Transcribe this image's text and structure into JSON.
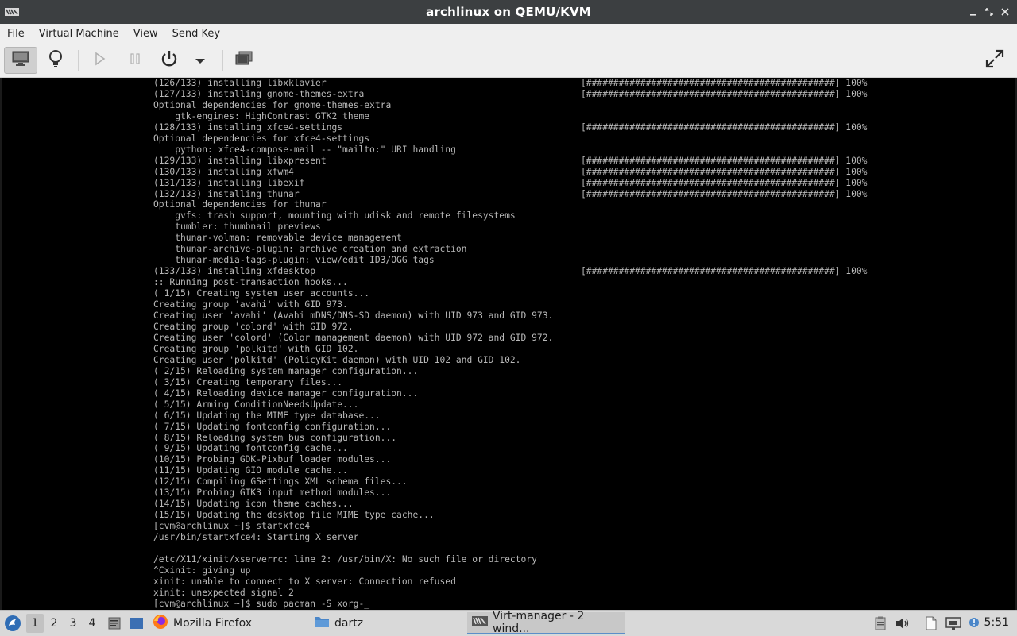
{
  "window": {
    "title": "archlinux on QEMU/KVM",
    "minimize_icon": "minimize-icon",
    "maximize_icon": "maximize-icon",
    "close_icon": "close-icon"
  },
  "menubar": {
    "items": [
      "File",
      "Virtual Machine",
      "View",
      "Send Key"
    ]
  },
  "toolbar": {
    "buttons": [
      "console-view",
      "details-view",
      "run",
      "pause",
      "shutdown",
      "shutdown-menu",
      "snapshots",
      "fullscreen"
    ]
  },
  "console": {
    "lines": [
      "(126/133) installing libxklavier",
      "(127/133) installing gnome-themes-extra",
      "Optional dependencies for gnome-themes-extra",
      "    gtk-engines: HighContrast GTK2 theme",
      "(128/133) installing xfce4-settings",
      "Optional dependencies for xfce4-settings",
      "    python: xfce4-compose-mail -- \"mailto:\" URI handling",
      "(129/133) installing libxpresent",
      "(130/133) installing xfwm4",
      "(131/133) installing libexif",
      "(132/133) installing thunar",
      "Optional dependencies for thunar",
      "    gvfs: trash support, mounting with udisk and remote filesystems",
      "    tumbler: thumbnail previews",
      "    thunar-volman: removable device management",
      "    thunar-archive-plugin: archive creation and extraction",
      "    thunar-media-tags-plugin: view/edit ID3/OGG tags",
      "(133/133) installing xfdesktop",
      ":: Running post-transaction hooks...",
      "( 1/15) Creating system user accounts...",
      "Creating group 'avahi' with GID 973.",
      "Creating user 'avahi' (Avahi mDNS/DNS-SD daemon) with UID 973 and GID 973.",
      "Creating group 'colord' with GID 972.",
      "Creating user 'colord' (Color management daemon) with UID 972 and GID 972.",
      "Creating group 'polkitd' with GID 102.",
      "Creating user 'polkitd' (PolicyKit daemon) with UID 102 and GID 102.",
      "( 2/15) Reloading system manager configuration...",
      "( 3/15) Creating temporary files...",
      "( 4/15) Reloading device manager configuration...",
      "( 5/15) Arming ConditionNeedsUpdate...",
      "( 6/15) Updating the MIME type database...",
      "( 7/15) Updating fontconfig configuration...",
      "( 8/15) Reloading system bus configuration...",
      "( 9/15) Updating fontconfig cache...",
      "(10/15) Probing GDK-Pixbuf loader modules...",
      "(11/15) Updating GIO module cache...",
      "(12/15) Compiling GSettings XML schema files...",
      "(13/15) Probing GTK3 input method modules...",
      "(14/15) Updating icon theme caches...",
      "(15/15) Updating the desktop file MIME type cache...",
      "[cvm@archlinux ~]$ startxfce4",
      "/usr/bin/startxfce4: Starting X server",
      "",
      "/etc/X11/xinit/xserverrc: line 2: /usr/bin/X: No such file or directory",
      "^Cxinit: giving up",
      "xinit: unable to connect to X server: Connection refused",
      "xinit: unexpected signal 2",
      "[cvm@archlinux ~]$ sudo pacman -S xorg-_"
    ],
    "progress_lines": [
      "[##############################################] 100%",
      "[##############################################] 100%",
      "",
      "",
      "[##############################################] 100%",
      "",
      "",
      "[##############################################] 100%",
      "[##############################################] 100%",
      "[##############################################] 100%",
      "[##############################################] 100%",
      "",
      "",
      "",
      "",
      "",
      "",
      "[##############################################] 100%"
    ]
  },
  "taskbar": {
    "workspaces": [
      "1",
      "2",
      "3",
      "4"
    ],
    "tasks": [
      {
        "label": "Mozilla Firefox",
        "icon": "firefox-icon"
      },
      {
        "label": "dartz",
        "icon": "folder-icon"
      },
      {
        "label": "Virt-manager - 2 wind...",
        "icon": "virt-manager-icon"
      }
    ],
    "clock": "5:51"
  }
}
